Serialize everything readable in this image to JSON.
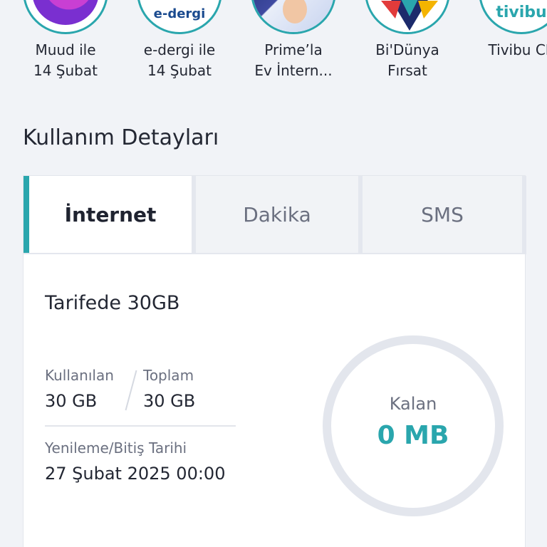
{
  "stories": [
    {
      "label": "Muud ile\n14 Şubat"
    },
    {
      "label": "e-dergi ile\n14 Şubat",
      "logo_text": "e-dergi"
    },
    {
      "label": "Prime’la\nEv İntern..."
    },
    {
      "label": "Bi'Dünya\nFırsat"
    },
    {
      "label": "Tivibu CE",
      "logo_text": "tivibu"
    }
  ],
  "section": {
    "title": "Kullanım Detayları"
  },
  "tabs": [
    {
      "label": "İnternet",
      "active": true
    },
    {
      "label": "Dakika",
      "active": false
    },
    {
      "label": "SMS",
      "active": false
    }
  ],
  "usage": {
    "tarife": "Tarifede 30GB",
    "used_label": "Kullanılan",
    "used_value": "30 GB",
    "total_label": "Toplam",
    "total_value": "30 GB",
    "renew_label": "Yenileme/Bitiş Tarihi",
    "renew_value": "27 Şubat 2025 00:00",
    "remaining_label": "Kalan",
    "remaining_value": "0 MB"
  },
  "colors": {
    "accent": "#2aa6ad",
    "background": "#f1f3f7"
  }
}
